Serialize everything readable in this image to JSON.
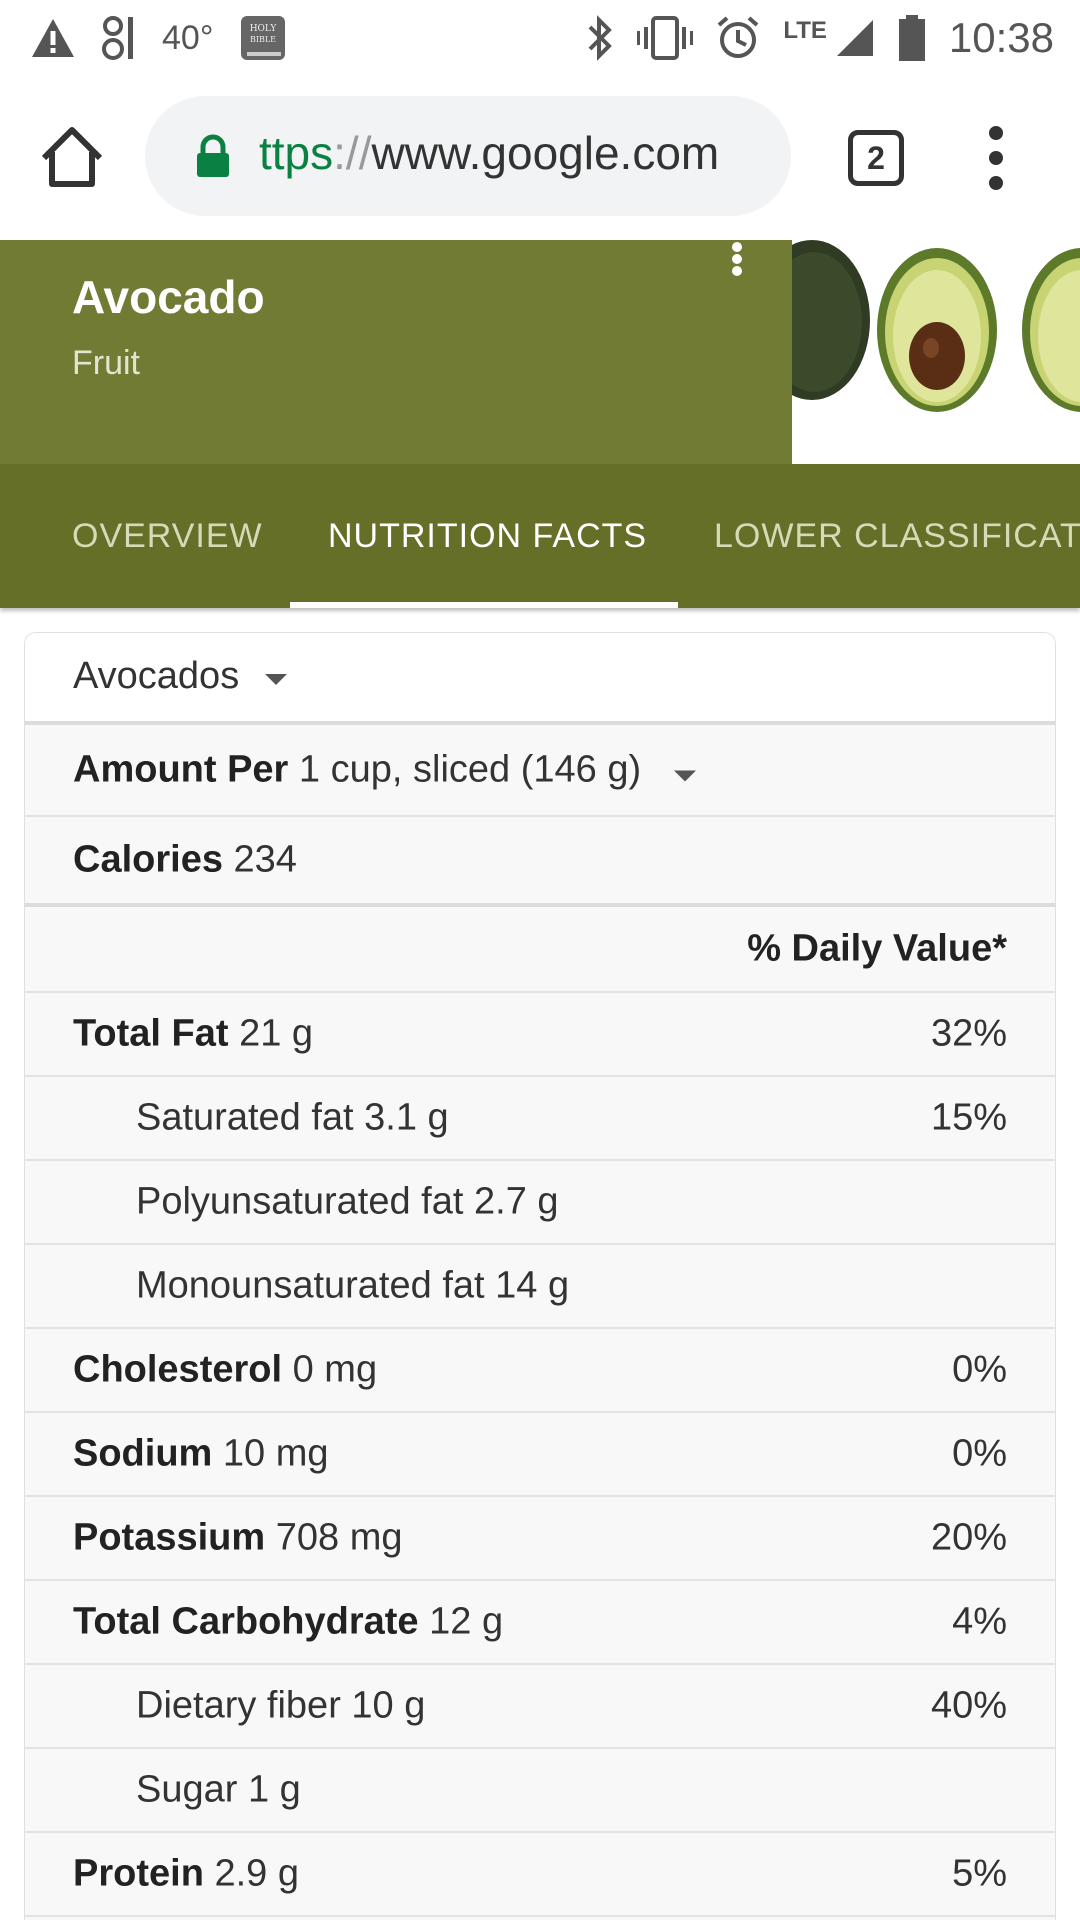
{
  "status_bar": {
    "left_items": [
      "warning-icon",
      "signal-strength-icon",
      "holy-bible-app-icon"
    ],
    "temperature": "40°",
    "bible_icon_text": "HOLY BIBLE",
    "network": "LTE",
    "time": "10:38"
  },
  "browser": {
    "url_scheme": "ttps",
    "url_sep": "://",
    "url_host": "www.google.com",
    "tab_count": "2",
    "secure_color": "#0b8043"
  },
  "knowledge_panel": {
    "title": "Avocado",
    "subtitle": "Fruit",
    "header_color": "#717b34",
    "tab_bar_color": "#656f28",
    "tabs": [
      {
        "label": "OVERVIEW",
        "active": false
      },
      {
        "label": "NUTRITION FACTS",
        "active": true
      },
      {
        "label": "LOWER CLASSIFICATI",
        "active": false
      }
    ]
  },
  "nutrition": {
    "food_select": "Avocados",
    "amount_label": "Amount Per",
    "amount_value": "1 cup, sliced (146 g)",
    "calories_label": "Calories",
    "calories_value": "234",
    "daily_value_header": "% Daily Value*",
    "rows": [
      {
        "name": "Total Fat",
        "amount": "21 g",
        "dv": "32%",
        "bold": true
      },
      {
        "name": "Saturated fat",
        "amount": "3.1 g",
        "dv": "15%",
        "bold": false
      },
      {
        "name": "Polyunsaturated fat",
        "amount": "2.7 g",
        "dv": "",
        "bold": false
      },
      {
        "name": "Monounsaturated fat",
        "amount": "14 g",
        "dv": "",
        "bold": false
      },
      {
        "name": "Cholesterol",
        "amount": "0 mg",
        "dv": "0%",
        "bold": true
      },
      {
        "name": "Sodium",
        "amount": "10 mg",
        "dv": "0%",
        "bold": true
      },
      {
        "name": "Potassium",
        "amount": "708 mg",
        "dv": "20%",
        "bold": true
      },
      {
        "name": "Total Carbohydrate",
        "amount": "12 g",
        "dv": "4%",
        "bold": true
      },
      {
        "name": "Dietary fiber",
        "amount": "10 g",
        "dv": "40%",
        "bold": false
      },
      {
        "name": "Sugar",
        "amount": "1 g",
        "dv": "",
        "bold": false
      },
      {
        "name": "Protein",
        "amount": "2.9 g",
        "dv": "5%",
        "bold": true
      }
    ]
  }
}
